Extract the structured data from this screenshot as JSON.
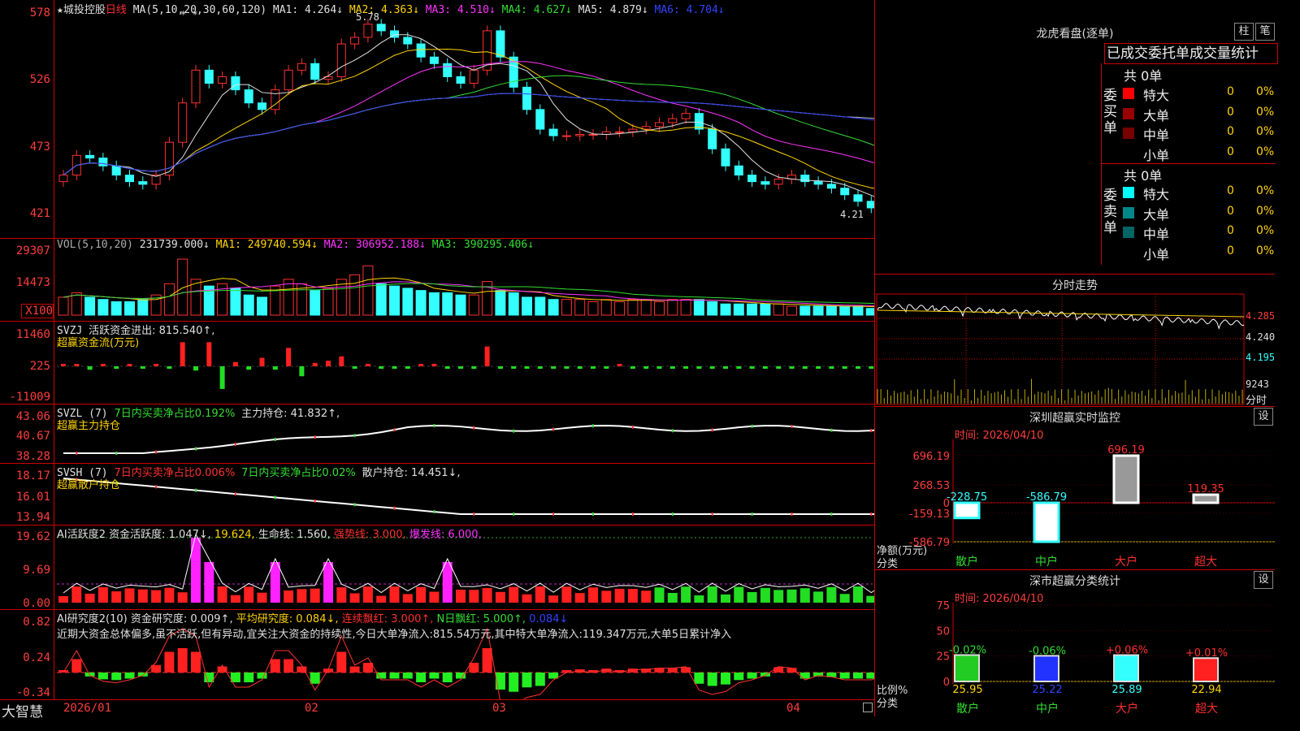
{
  "app": {
    "brand": "大智慧"
  },
  "chart_header": {
    "star": "★",
    "stock_name": "城投控股",
    "period": "日线",
    "ma_params": "MA(5,10,20,30,60,120)",
    "ma1": "MA1: 4.264↓",
    "ma2": "MA2: 4.363↓",
    "ma3": "MA3: 4.510↓",
    "ma4": "MA4: 4.627↓",
    "ma5": "MA5: 4.879↓",
    "ma6": "MA6: 4.704↓",
    "high_label": "5.78",
    "low_label": "4.21",
    "star_marks": "* *"
  },
  "price_axis": [
    "578",
    "526",
    "473",
    "421"
  ],
  "vol_panel": {
    "header": "VOL(5,10,20)",
    "value": "231739.000↓",
    "ma1": "MA1: 249740.594↓",
    "ma2": "MA2: 306952.188↓",
    "ma3": "MA3: 390295.406↓",
    "axis": [
      "29307",
      "14473",
      "X100"
    ]
  },
  "svzj_panel": {
    "name": "SVZJ",
    "label": "活跃资金进出: 815.540↑,",
    "sub": "超赢资金流(万元)",
    "axis": [
      "11460",
      "225",
      "-11009"
    ]
  },
  "svzl_panel": {
    "name": "SVZL (7)",
    "ratio": "7日内买卖净占比0.192%",
    "hold": "主力持仓: 41.832↑,",
    "sub": "超赢主力持仓",
    "axis": [
      "43.06",
      "40.67",
      "38.28"
    ]
  },
  "svsh_panel": {
    "name": "SVSH (7)",
    "ratio1": "7日内买卖净占比0.006%",
    "ratio2": "7日内买卖净占比0.02%",
    "hold": "散户持仓: 14.451↓,",
    "sub": "超赢散户持仓",
    "axis": [
      "18.17",
      "16.01",
      "13.94"
    ]
  },
  "ai_active": {
    "name": "AI活跃度2",
    "act": "资金活跃度: 1.047↓,",
    "v2": "19.624,",
    "life": "生命线: 1.560,",
    "strong": "强势线: 3.000,",
    "burst": "爆发线: 6.000,",
    "axis": [
      "19.62",
      "9.69",
      "0.00"
    ]
  },
  "ai_research": {
    "name": "AI研究度2(10)",
    "res": "资金研究度: 0.009↑,",
    "avg": "平均研究度: 0.084↓,",
    "red": "连续飘红: 3.000↑,",
    "nred": "N日飘红: 5.000↑,",
    "v": "0.084↓",
    "note": "近期大资金总体偏多,虽不活跃,但有异动,宜关注大资金的持续性,今日大单净流入:815.54万元,其中特大单净流入:119.347万元,大单5日累计净入",
    "axis": [
      "0.82",
      "0.24",
      "-0.34"
    ]
  },
  "date_axis": [
    "2026/01",
    "02",
    "03",
    "04"
  ],
  "lhb": {
    "title": "龙虎看盘(逐单)",
    "btn1": "柱",
    "btn2": "笔",
    "subtitle": "已成交委托单成交量统计",
    "buy_label": "委买单",
    "sell_label": "委卖单",
    "buy_total": "共 0单",
    "sell_total": "共 0单",
    "buy_rows": [
      {
        "name": "特大",
        "count": "0",
        "pct": "0%",
        "color": "#ff0000"
      },
      {
        "name": "大单",
        "count": "0",
        "pct": "0%",
        "color": "#990000"
      },
      {
        "name": "中单",
        "count": "0",
        "pct": "0%",
        "color": "#770000"
      },
      {
        "name": "小单",
        "count": "0",
        "pct": "0%",
        "color": "#000000"
      }
    ],
    "sell_rows": [
      {
        "name": "特大",
        "count": "0",
        "pct": "0%",
        "color": "#00ffff"
      },
      {
        "name": "大单",
        "count": "0",
        "pct": "0%",
        "color": "#008888"
      },
      {
        "name": "中单",
        "count": "0",
        "pct": "0%",
        "color": "#006666"
      },
      {
        "name": "小单",
        "count": "0",
        "pct": "0%",
        "color": "#000000"
      }
    ]
  },
  "intraday": {
    "title": "分时走势",
    "axis": [
      "4.285",
      "4.240",
      "4.195"
    ],
    "vol": "9243",
    "vol_label": "分时"
  },
  "sz_monitor": {
    "title": "深圳超赢实时监控",
    "btn": "设",
    "time": "时间: 2026/04/10",
    "axis": [
      "696.19",
      "268.53",
      "0",
      "-159.13",
      "-586.79"
    ],
    "y_label": "净额(万元)",
    "x_label": "分类",
    "categories": [
      "散户",
      "中户",
      "大户",
      "超大"
    ],
    "values": [
      -228.75,
      -586.79,
      696.19,
      119.35
    ],
    "value_labels": [
      "-228.75",
      "-586.79",
      "696.19",
      "119.35"
    ]
  },
  "sz_class": {
    "title": "深市超赢分类统计",
    "btn": "设",
    "time": "时间: 2026/04/10",
    "axis": [
      "75",
      "50",
      "25",
      "0"
    ],
    "y_label": "比例%",
    "x_label": "分类",
    "categories": [
      "散户",
      "中户",
      "大户",
      "超大"
    ],
    "values": [
      25.95,
      25.22,
      25.89,
      22.94
    ],
    "value_labels": [
      "25.95",
      "25.22",
      "25.89",
      "22.94"
    ],
    "changes": [
      "-0.02%",
      "-0.06%",
      "+0.06%",
      "+0.01%"
    ]
  },
  "chart_data": [
    {
      "type": "candlestick",
      "title": "城投控股 日线",
      "ylim": [
        4.21,
        5.78
      ],
      "x": [
        "2026/01",
        "02",
        "03",
        "04"
      ],
      "close": [
        4.55,
        4.7,
        4.68,
        4.62,
        4.55,
        4.5,
        4.48,
        4.55,
        4.8,
        5.1,
        5.35,
        5.25,
        5.3,
        5.2,
        5.1,
        5.05,
        5.2,
        5.35,
        5.4,
        5.28,
        5.3,
        5.55,
        5.6,
        5.7,
        5.65,
        5.6,
        5.55,
        5.45,
        5.4,
        5.3,
        5.25,
        5.35,
        5.65,
        5.45,
        5.22,
        5.05,
        4.9,
        4.85,
        4.85,
        4.86,
        4.86,
        4.88,
        4.88,
        4.9,
        4.92,
        4.95,
        4.98,
        5.02,
        4.9,
        4.75,
        4.62,
        4.55,
        4.5,
        4.48,
        4.52,
        4.55,
        4.5,
        4.48,
        4.45,
        4.4,
        4.35,
        4.3,
        4.28,
        4.3,
        4.25,
        4.26
      ],
      "ma1_last": 4.264,
      "ma2_last": 4.363,
      "ma3_last": 4.51,
      "ma4_last": 4.627,
      "ma5_last": 4.879,
      "ma6_last": 4.704
    },
    {
      "type": "bar",
      "title": "VOL",
      "ylim": [
        0,
        29307
      ],
      "values": [
        8,
        10,
        8,
        7,
        6,
        6,
        7,
        9,
        14,
        25,
        16,
        13,
        14,
        12,
        9,
        8,
        13,
        16,
        14,
        11,
        12,
        16,
        18,
        22,
        14,
        13,
        12,
        11,
        10,
        10,
        9,
        9,
        15,
        11,
        10,
        8,
        8,
        7,
        7,
        7,
        6,
        7,
        6,
        7,
        7,
        6,
        7,
        7,
        7,
        6,
        5,
        5,
        5,
        5,
        5,
        4,
        4,
        4,
        4,
        4,
        4,
        3,
        3,
        3,
        3,
        3
      ]
    },
    {
      "type": "bar",
      "title": "SVZJ 超赢资金流(万元)",
      "ylim": [
        -11009,
        11460
      ],
      "values": [
        200,
        800,
        -1200,
        300,
        -100,
        200,
        -100,
        800,
        -800,
        8500,
        -1500,
        8500,
        -8000,
        1500,
        -1200,
        3000,
        -1200,
        6500,
        -3500,
        1200,
        2000,
        3500,
        -500,
        300,
        -300,
        -700,
        -400,
        300,
        400,
        -200,
        -600,
        -900,
        7000,
        -500,
        -600,
        -300,
        -400,
        -400,
        -500,
        -300,
        -400,
        -300,
        500,
        -200,
        -500,
        -300,
        -200,
        -600,
        -700,
        -500,
        -400,
        -600,
        -500,
        -400,
        -300,
        -200,
        -400,
        -300,
        -200,
        -300,
        -400,
        -500,
        -200,
        -300,
        -300,
        -100
      ]
    },
    {
      "type": "line",
      "title": "超赢主力持仓",
      "ylim": [
        38.28,
        43.06
      ]
    },
    {
      "type": "line",
      "title": "超赢散户持仓",
      "ylim": [
        13.94,
        18.17
      ]
    },
    {
      "type": "bar",
      "title": "AI活跃度2",
      "ylim": [
        0,
        19.62
      ]
    },
    {
      "type": "bar",
      "title": "AI研究度2(10)",
      "ylim": [
        -0.34,
        0.82
      ]
    },
    {
      "type": "bar",
      "title": "深圳超赢实时监控",
      "categories": [
        "散户",
        "中户",
        "大户",
        "超大"
      ],
      "values": [
        -228.75,
        -586.79,
        696.19,
        119.35
      ],
      "ylim": [
        -586.79,
        696.19
      ]
    },
    {
      "type": "bar",
      "title": "深市超赢分类统计",
      "categories": [
        "散户",
        "中户",
        "大户",
        "超大"
      ],
      "values": [
        25.95,
        25.22,
        25.89,
        22.94
      ],
      "ylim": [
        0,
        75
      ]
    }
  ]
}
